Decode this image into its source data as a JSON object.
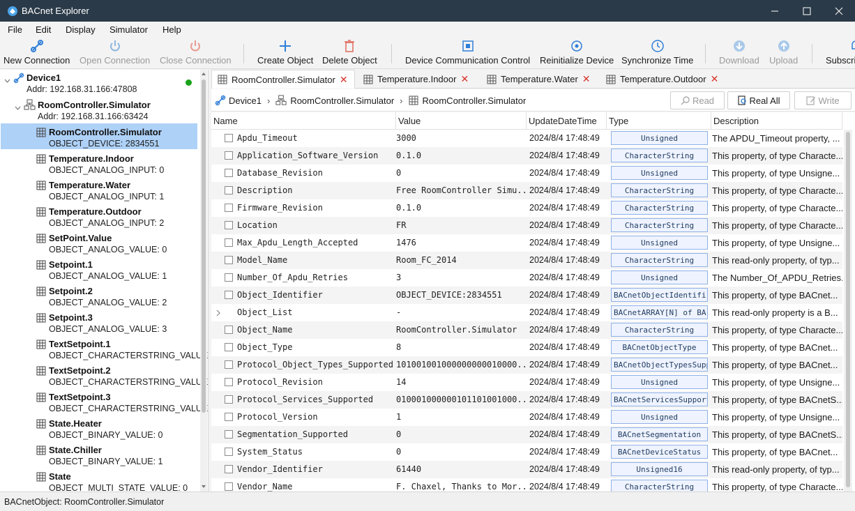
{
  "window": {
    "title": "BACnet Explorer",
    "minimize": "—",
    "maximize": "☐",
    "close": "✕"
  },
  "menu": [
    "File",
    "Edit",
    "Display",
    "Simulator",
    "Help"
  ],
  "toolbar": {
    "new_connection": "New Connection",
    "open_connection": "Open Connection",
    "close_connection": "Close Connection",
    "create_object": "Create Object",
    "delete_object": "Delete Object",
    "device_comm_control": "Device Communication Control",
    "reinitialize_device": "Reinitialize Device",
    "synchronize_time": "Synchronize Time",
    "download": "Download",
    "upload": "Upload",
    "subscribe": "Subscri"
  },
  "tree": {
    "device": {
      "name": "Device1",
      "addr": "Addr:  192.168.31.166:47808",
      "status_color": "#1aa31a"
    },
    "controller": {
      "name": "RoomController.Simulator",
      "addr": "Addr:  192.168.31.166:63424"
    },
    "objects": [
      {
        "name": "RoomController.Simulator",
        "type": "OBJECT_DEVICE:  2834551"
      },
      {
        "name": "Temperature.Indoor",
        "type": "OBJECT_ANALOG_INPUT:  0"
      },
      {
        "name": "Temperature.Water",
        "type": "OBJECT_ANALOG_INPUT:  1"
      },
      {
        "name": "Temperature.Outdoor",
        "type": "OBJECT_ANALOG_INPUT:  2"
      },
      {
        "name": "SetPoint.Value",
        "type": "OBJECT_ANALOG_VALUE:  0"
      },
      {
        "name": "Setpoint.1",
        "type": "OBJECT_ANALOG_VALUE:  1"
      },
      {
        "name": "Setpoint.2",
        "type": "OBJECT_ANALOG_VALUE:  2"
      },
      {
        "name": "Setpoint.3",
        "type": "OBJECT_ANALOG_VALUE:  3"
      },
      {
        "name": "TextSetpoint.1",
        "type": "OBJECT_CHARACTERSTRING_VALUE:"
      },
      {
        "name": "TextSetpoint.2",
        "type": "OBJECT_CHARACTERSTRING_VALUE:"
      },
      {
        "name": "TextSetpoint.3",
        "type": "OBJECT_CHARACTERSTRING_VALUE:"
      },
      {
        "name": "State.Heater",
        "type": "OBJECT_BINARY_VALUE:  0"
      },
      {
        "name": "State.Chiller",
        "type": "OBJECT_BINARY_VALUE:  1"
      },
      {
        "name": "State",
        "type": "OBJECT_MULTI_STATE_VALUE:  0"
      }
    ]
  },
  "tabs": [
    "RoomController.Simulator",
    "Temperature.Indoor",
    "Temperature.Water",
    "Temperature.Outdoor"
  ],
  "breadcrumb": [
    "Device1",
    "RoomController.Simulator",
    "RoomController.Simulator"
  ],
  "actions": {
    "read": "Read",
    "read_all": "Real All",
    "write": "Write"
  },
  "columns": [
    "Name",
    "Value",
    "UpdateDateTime",
    "Type",
    "Description"
  ],
  "rows": [
    {
      "name": "Apdu_Timeout",
      "value": "3000",
      "time": "2024/8/4 17:48:49",
      "type": "Unsigned",
      "desc": "The APDU_Timeout property, ..."
    },
    {
      "name": "Application_Software_Version",
      "value": "0.1.0",
      "time": "2024/8/4 17:48:49",
      "type": "CharacterString",
      "desc": "This property, of type Characte..."
    },
    {
      "name": "Database_Revision",
      "value": "0",
      "time": "2024/8/4 17:48:49",
      "type": "Unsigned",
      "desc": "This property, of type Unsigne..."
    },
    {
      "name": "Description",
      "value": "Free RoomController Simu...",
      "time": "2024/8/4 17:48:49",
      "type": "CharacterString",
      "desc": "This property, of type Characte..."
    },
    {
      "name": "Firmware_Revision",
      "value": "0.1.0",
      "time": "2024/8/4 17:48:49",
      "type": "CharacterString",
      "desc": "This property, of type Characte..."
    },
    {
      "name": "Location",
      "value": "FR",
      "time": "2024/8/4 17:48:49",
      "type": "CharacterString",
      "desc": "This property, of type Characte..."
    },
    {
      "name": "Max_Apdu_Length_Accepted",
      "value": "1476",
      "time": "2024/8/4 17:48:49",
      "type": "Unsigned",
      "desc": "This property, of type Unsigne..."
    },
    {
      "name": "Model_Name",
      "value": "Room_FC_2014",
      "time": "2024/8/4 17:48:49",
      "type": "CharacterString",
      "desc": "This read-only property, of typ..."
    },
    {
      "name": "Number_Of_Apdu_Retries",
      "value": "3",
      "time": "2024/8/4 17:48:49",
      "type": "Unsigned",
      "desc": "The Number_Of_APDU_Retries..."
    },
    {
      "name": "Object_Identifier",
      "value": "OBJECT_DEVICE:2834551",
      "time": "2024/8/4 17:48:49",
      "type": "BACnetObjectIdentifi",
      "desc": "This property, of type BACnet..."
    },
    {
      "name": "Object_List",
      "value": "-",
      "time": "2024/8/4 17:48:49",
      "type": "BACnetARRAY[N] of BA",
      "desc": "This read-only property is a B..."
    },
    {
      "name": "Object_Name",
      "value": "RoomController.Simulator",
      "time": "2024/8/4 17:48:49",
      "type": "CharacterString",
      "desc": "This property, of type Characte..."
    },
    {
      "name": "Object_Type",
      "value": "8",
      "time": "2024/8/4 17:48:49",
      "type": "BACnetObjectType",
      "desc": "This property, of type BACnet..."
    },
    {
      "name": "Protocol_Object_Types_Supported",
      "value": "101001001000000000010000...",
      "time": "2024/8/4 17:48:49",
      "type": "BACnetObjectTypesSupp",
      "desc": "This property, of type BACnet..."
    },
    {
      "name": "Protocol_Revision",
      "value": "14",
      "time": "2024/8/4 17:48:49",
      "type": "Unsigned",
      "desc": "This property, of type Unsigne..."
    },
    {
      "name": "Protocol_Services_Supported",
      "value": "010001000000101101001000...",
      "time": "2024/8/4 17:48:49",
      "type": "BACnetServicesSupport",
      "desc": "This property, of type BACnetS..."
    },
    {
      "name": "Protocol_Version",
      "value": "1",
      "time": "2024/8/4 17:48:49",
      "type": "Unsigned",
      "desc": "This property, of type Unsigne..."
    },
    {
      "name": "Segmentation_Supported",
      "value": "0",
      "time": "2024/8/4 17:48:49",
      "type": "BACnetSegmentation",
      "desc": "This property, of type BACnetS..."
    },
    {
      "name": "System_Status",
      "value": "0",
      "time": "2024/8/4 17:48:49",
      "type": "BACnetDeviceStatus",
      "desc": "This property, of type BACnet..."
    },
    {
      "name": "Vendor_Identifier",
      "value": "61440",
      "time": "2024/8/4 17:48:49",
      "type": "Unsigned16",
      "desc": "This read-only property, of typ..."
    },
    {
      "name": "Vendor_Name",
      "value": "F. Chaxel, Thanks to Mor...",
      "time": "2024/8/4 17:48:49",
      "type": "CharacterString",
      "desc": "This property, of type Characte..."
    }
  ],
  "status": "BACnetObject: RoomController.Simulator"
}
